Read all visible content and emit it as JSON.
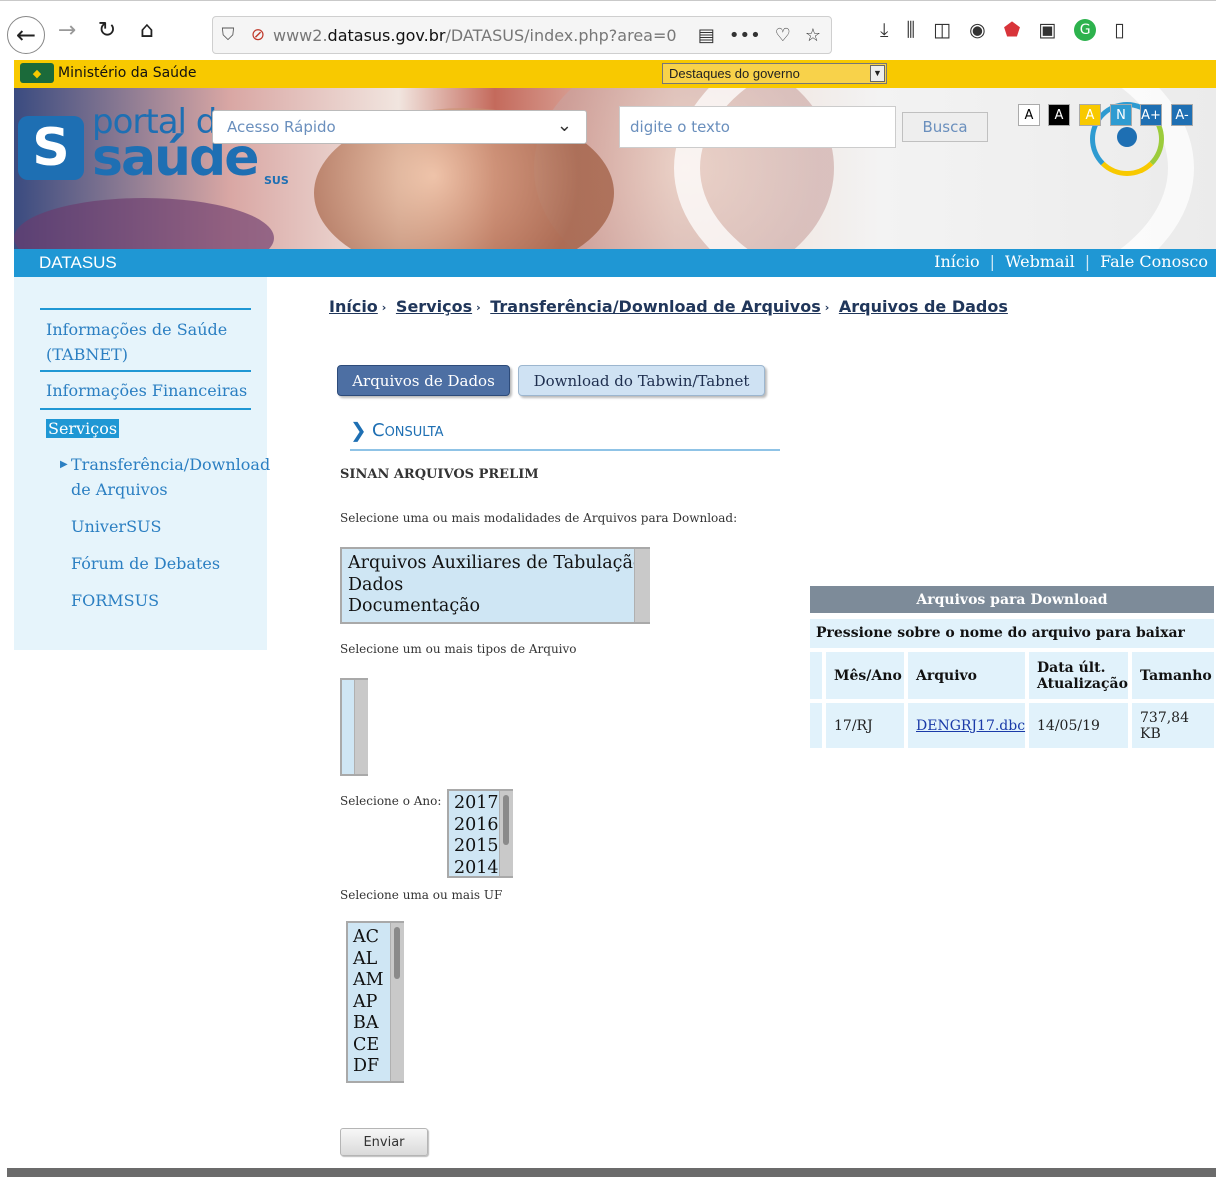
{
  "browser": {
    "url_prefix": "www2.",
    "url_domain": "datasus.gov.br",
    "url_path": "/DATASUS/index.php?area=0",
    "icons": [
      "back-icon",
      "forward-icon",
      "reload-icon",
      "home-icon",
      "shield-icon",
      "insecure-lock-icon",
      "reader-icon",
      "more-icon",
      "pocket-icon",
      "star-icon",
      "download-icon",
      "library-icon",
      "sidebar-icon",
      "account-icon",
      "ublock-icon",
      "reader-view-icon",
      "grammarly-icon",
      "page-icon"
    ]
  },
  "gov_bar": {
    "title": "Ministério da Saúde",
    "select_value": "Destaques do governo"
  },
  "header": {
    "logo_line1": "portal da",
    "logo_line2": "saúde",
    "logo_s": "S",
    "logo_sus": "SUS",
    "quick_access": "Acesso Rápido",
    "search_placeholder": "digite o texto",
    "search_button": "Busca",
    "accessibility": [
      "A",
      "A",
      "A",
      "N",
      "A+",
      "A-"
    ]
  },
  "blue_bar": {
    "site": "DATASUS",
    "links": [
      "Início",
      "Webmail",
      "Fale Conosco"
    ],
    "separator": "|"
  },
  "sidebar": {
    "item1_line1": "Informações de Saúde",
    "item1_line2": "(TABNET)",
    "item2": "Informações Financeiras",
    "item3": "Serviços",
    "sub1_line1": "Transferência/Download",
    "sub1_line2": "de Arquivos",
    "sub2": "UniverSUS",
    "sub3": "Fórum de Debates",
    "sub4": "FORMSUS"
  },
  "breadcrumb": {
    "items": [
      "Início",
      "Serviços",
      "Transferência/Download de Arquivos",
      "Arquivos de Dados"
    ],
    "separator": "›"
  },
  "tabs": {
    "active": "Arquivos de Dados",
    "inactive": "Download do Tabwin/Tabnet"
  },
  "consulta": {
    "title": "Consulta",
    "section": "SINAN ARQUIVOS PRELIM",
    "modalidade_label": "Selecione uma ou mais modalidades de Arquivos para Download:",
    "modalidades": [
      "Arquivos Auxiliares de Tabulação",
      "Dados",
      "Documentação"
    ],
    "tipo_label": "Selecione um ou mais tipos de Arquivo",
    "ano_label": "Selecione o Ano:",
    "anos": [
      "2017",
      "2016",
      "2015",
      "2014"
    ],
    "uf_label": "Selecione uma ou mais UF",
    "ufs": [
      "AC",
      "AL",
      "AM",
      "AP",
      "BA",
      "CE",
      "DF"
    ],
    "submit": "Enviar"
  },
  "downloads": {
    "title": "Arquivos para Download",
    "instruction": "Pressione sobre o nome do arquivo para baixar",
    "columns": [
      "Mês/Ano",
      "Arquivo",
      "Data últ. Atualização",
      "Tamanho"
    ],
    "rows": [
      {
        "mes_ano": "17/RJ",
        "arquivo": "DENGRJ17.dbc",
        "data": "14/05/19",
        "tamanho": "737,84 KB"
      }
    ]
  },
  "colors": {
    "gov_yellow": "#f8c900",
    "datasus_blue": "#1f97d4",
    "tab_active": "#4d6fa3",
    "table_header": "#7d8b99",
    "table_cell": "#e1f2fb"
  }
}
